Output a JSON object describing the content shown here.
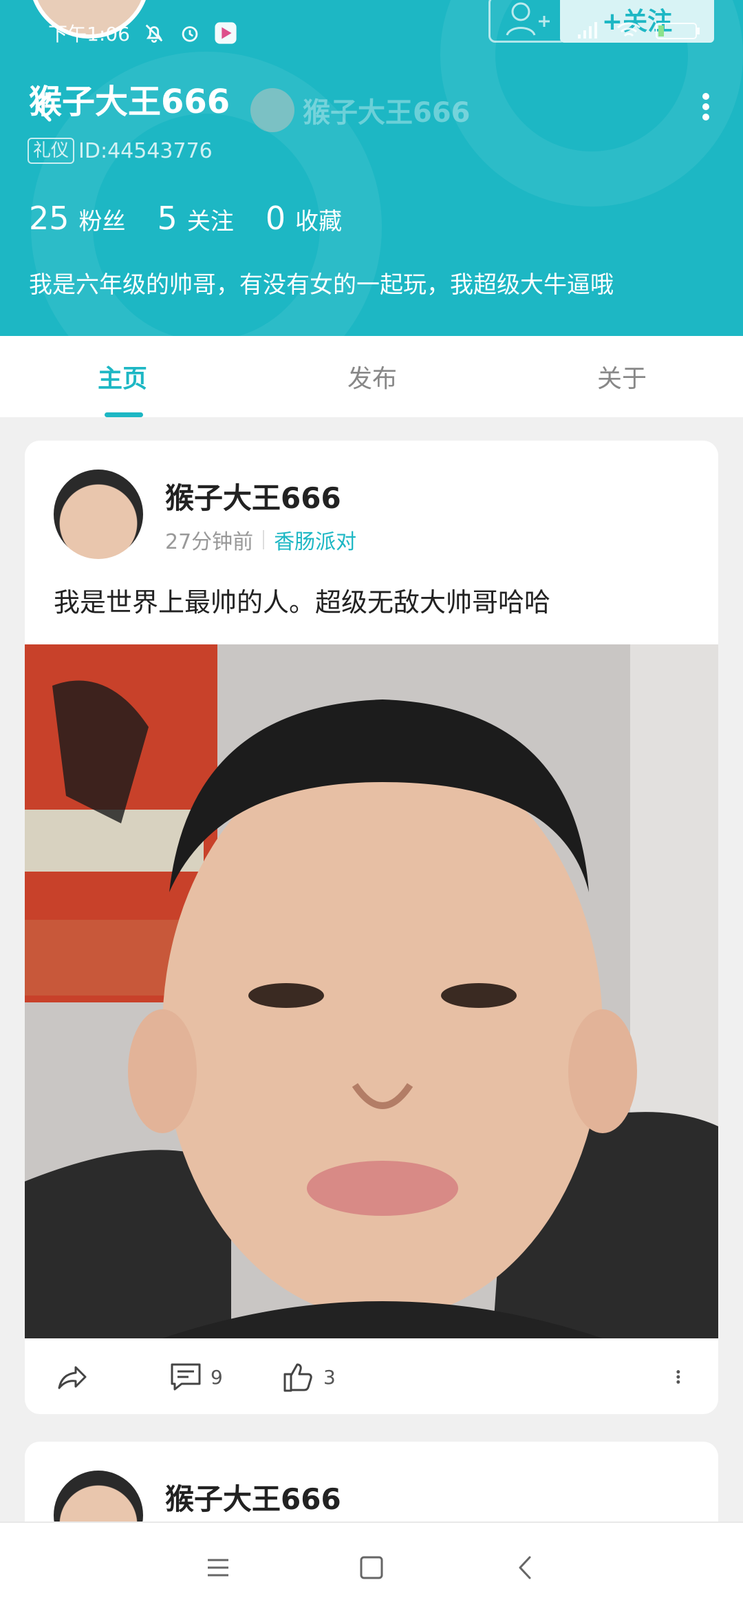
{
  "status_bar": {
    "time": "下午1:06"
  },
  "header": {
    "follow_label": "+关注",
    "username": "猴子大王666",
    "faded_username": "猴子大王666",
    "tag": "礼仪",
    "user_id": "ID:44543776",
    "stats": [
      {
        "value": "25",
        "label": "粉丝"
      },
      {
        "value": "5",
        "label": "关注"
      },
      {
        "value": "0",
        "label": "收藏"
      }
    ],
    "bio": "我是六年级的帅哥，有没有女的一起玩，我超级大牛逼哦"
  },
  "tabs": [
    {
      "label": "主页",
      "active": true
    },
    {
      "label": "发布",
      "active": false
    },
    {
      "label": "关于",
      "active": false
    }
  ],
  "post": {
    "author": "猴子大王666",
    "time_ago": "27分钟前",
    "topic": "香肠派对",
    "text": "我是世界上最帅的人。超级无敌大帅哥哈哈",
    "comments": "9",
    "likes": "3"
  },
  "post2": {
    "author": "猴子大王666"
  },
  "colors": {
    "accent": "#1db7c4",
    "background": "#f0f0f0"
  },
  "icons": [
    "back-icon",
    "more-icon",
    "share-icon",
    "comment-icon",
    "like-icon",
    "menu-icon",
    "home-icon",
    "nav-back-icon"
  ]
}
